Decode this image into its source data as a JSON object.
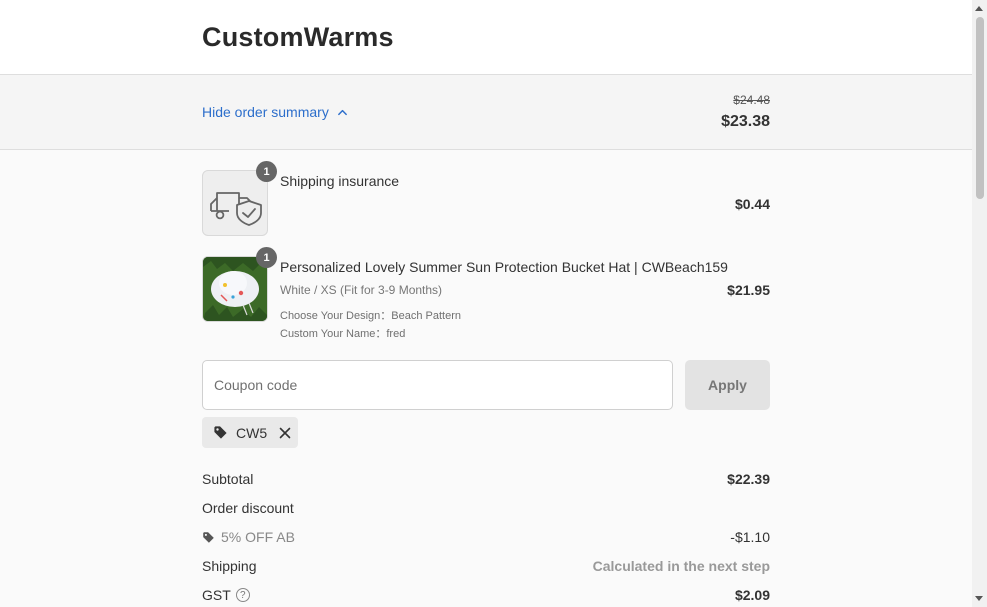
{
  "header": {
    "brand": "CustomWarms"
  },
  "summary_toggle": {
    "label": "Hide order summary",
    "compare_price": "$24.48",
    "total_price": "$23.38"
  },
  "items": [
    {
      "title": "Shipping insurance",
      "quantity": "1",
      "price": "$0.44",
      "icon": "truck-shield-icon"
    },
    {
      "title": "Personalized Lovely Summer Sun Protection Bucket Hat | CWBeach159",
      "quantity": "1",
      "variant": "White / XS (Fit for 3-9 Months)",
      "properties": [
        "Choose Your Design：Beach Pattern",
        "Custom Your Name：fred"
      ],
      "price": "$21.95"
    }
  ],
  "coupon": {
    "placeholder": "Coupon code",
    "apply_label": "Apply",
    "applied_code": "CW5"
  },
  "totals": {
    "subtotal_label": "Subtotal",
    "subtotal_value": "$22.39",
    "discount_label": "Order discount",
    "discount_name": "5% OFF AB",
    "discount_value": "-$1.10",
    "shipping_label": "Shipping",
    "shipping_value": "Calculated in the next step",
    "gst_label": "GST",
    "gst_value": "$2.09"
  },
  "colors": {
    "link": "#2c6ecb",
    "badge": "#666666",
    "toggle_bg": "#f5f5f5"
  }
}
